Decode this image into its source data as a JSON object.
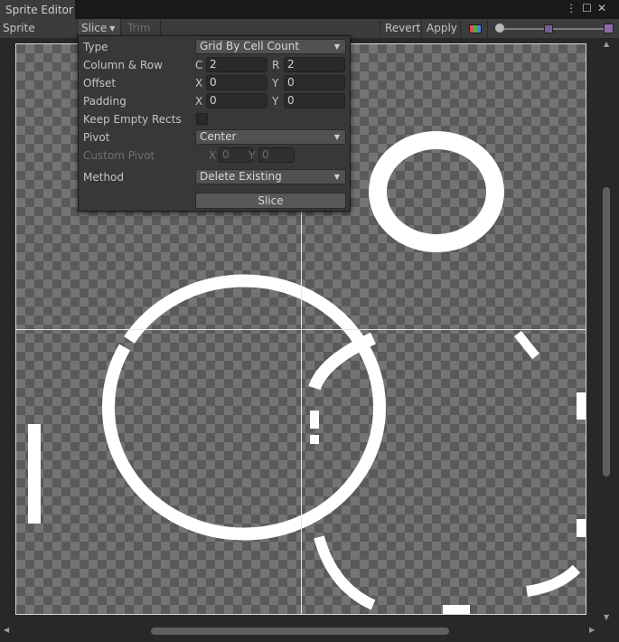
{
  "window": {
    "tab_title": "Sprite Editor"
  },
  "toolbar": {
    "mode_label": "Sprite Editor",
    "slice_label": "Slice",
    "trim_label": "Trim",
    "revert_label": "Revert",
    "apply_label": "Apply",
    "channel_icon": "rgb-channels-icon",
    "zoom_slider_value": 0.0,
    "mip_slider_value": 0.45
  },
  "slice_popup": {
    "type_label": "Type",
    "type_value": "Grid By Cell Count",
    "column_row_label": "Column & Row",
    "c_axis": "C",
    "c_value": "2",
    "r_axis": "R",
    "r_value": "2",
    "offset_label": "Offset",
    "offset_x_axis": "X",
    "offset_x": "0",
    "offset_y_axis": "Y",
    "offset_y": "0",
    "padding_label": "Padding",
    "padding_x_axis": "X",
    "padding_x": "0",
    "padding_y_axis": "Y",
    "padding_y": "0",
    "keep_empty_label": "Keep Empty Rects",
    "keep_empty_checked": false,
    "pivot_label": "Pivot",
    "pivot_value": "Center",
    "custom_pivot_label": "Custom Pivot",
    "custom_x_axis": "X",
    "custom_x": "0",
    "custom_y_axis": "Y",
    "custom_y": "0",
    "method_label": "Method",
    "method_value": "Delete Existing",
    "slice_button": "Slice"
  },
  "canvas": {
    "grid_columns": 2,
    "grid_rows": 2
  }
}
